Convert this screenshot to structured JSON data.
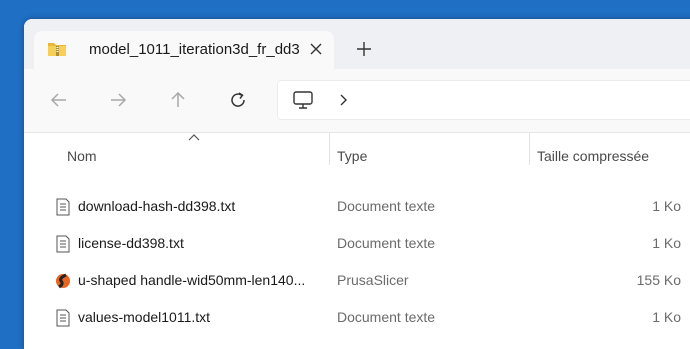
{
  "tab": {
    "title": "model_1011_iteration3d_fr_dd3",
    "icon": "zip-folder-icon"
  },
  "toolbar": {
    "back": "back-arrow-icon",
    "forward": "forward-arrow-icon",
    "up": "up-arrow-icon",
    "refresh": "refresh-icon",
    "location_icon": "monitor-icon"
  },
  "columns": {
    "name": "Nom",
    "type": "Type",
    "compressed_size": "Taille compressée"
  },
  "files": [
    {
      "name": "download-hash-dd398.txt",
      "type": "Document texte",
      "size": "1 Ko",
      "icon": "text-file-icon"
    },
    {
      "name": "license-dd398.txt",
      "type": "Document texte",
      "size": "1 Ko",
      "icon": "text-file-icon"
    },
    {
      "name": "u-shaped handle-wid50mm-len140...",
      "type": "PrusaSlicer",
      "size": "155 Ko",
      "icon": "prusaslicer-icon"
    },
    {
      "name": "values-model1011.txt",
      "type": "Document texte",
      "size": "1 Ko",
      "icon": "text-file-icon"
    }
  ],
  "colors": {
    "desktop": "#1f6fc4",
    "tabbar": "#eef0f3",
    "prusa_orange": "#e8641f"
  }
}
